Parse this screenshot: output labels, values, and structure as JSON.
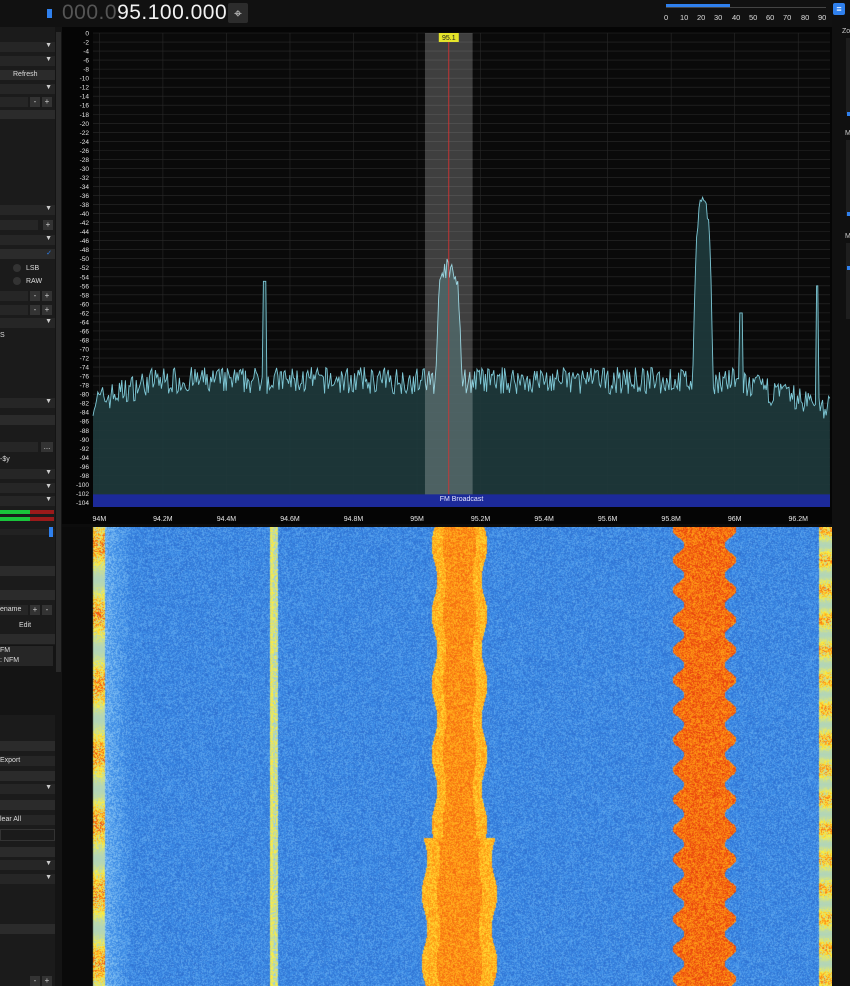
{
  "frequency": {
    "dim_part": "000.0",
    "bright_part": "95.100.000"
  },
  "scale_labels": [
    "0",
    "10",
    "20",
    "30",
    "40",
    "50",
    "60",
    "70",
    "80",
    "90"
  ],
  "sidebar": {
    "refresh_label": "Refresh",
    "lsb_label": "LSB",
    "raw_label": "RAW",
    "rename_label": "ename",
    "edit_label": "Edit",
    "list_items": [
      "FM",
      ": NFM"
    ],
    "export_label": "Export",
    "clear_all_label": "lear All",
    "text_s": "S",
    "text_sy": "-$y",
    "dots_label": "..."
  },
  "spectrum": {
    "y_ticks": [
      "0",
      "-2",
      "-4",
      "-6",
      "-8",
      "-10",
      "-12",
      "-14",
      "-16",
      "-18",
      "-20",
      "-22",
      "-24",
      "-26",
      "-28",
      "-30",
      "-32",
      "-34",
      "-36",
      "-38",
      "-40",
      "-42",
      "-44",
      "-46",
      "-48",
      "-50",
      "-52",
      "-54",
      "-56",
      "-58",
      "-60",
      "-62",
      "-64",
      "-66",
      "-68",
      "-70",
      "-72",
      "-74",
      "-76",
      "-78",
      "-80",
      "-82",
      "-84",
      "-86",
      "-88",
      "-90",
      "-92",
      "-94",
      "-96",
      "-98",
      "-100",
      "-102",
      "-104"
    ],
    "x_ticks": [
      "94M",
      "94.2M",
      "94.4M",
      "94.6M",
      "94.8M",
      "95M",
      "95.2M",
      "95.4M",
      "95.6M",
      "95.8M",
      "96M",
      "96.2M"
    ],
    "x_tick_values": [
      94.0,
      94.2,
      94.4,
      94.6,
      94.8,
      95.0,
      95.2,
      95.4,
      95.6,
      95.8,
      96.0,
      96.2
    ],
    "freq_min": 93.98,
    "freq_max": 96.3,
    "db_min": -105,
    "db_max": 0,
    "vfo_label": "95.1",
    "vfo_freq": 95.1,
    "vfo_bandwidth_mhz": 0.15,
    "band_label": "FM Broadcast",
    "trace_color": "#7ec8d6",
    "fill_color": "#1e3a3c",
    "band_color": "#1c2a9a"
  },
  "right_panel": {
    "labels": [
      "Zo",
      "M",
      "M"
    ]
  },
  "colors": {
    "accent": "#2f80ed",
    "vfo_label_bg": "#e5e52a"
  }
}
